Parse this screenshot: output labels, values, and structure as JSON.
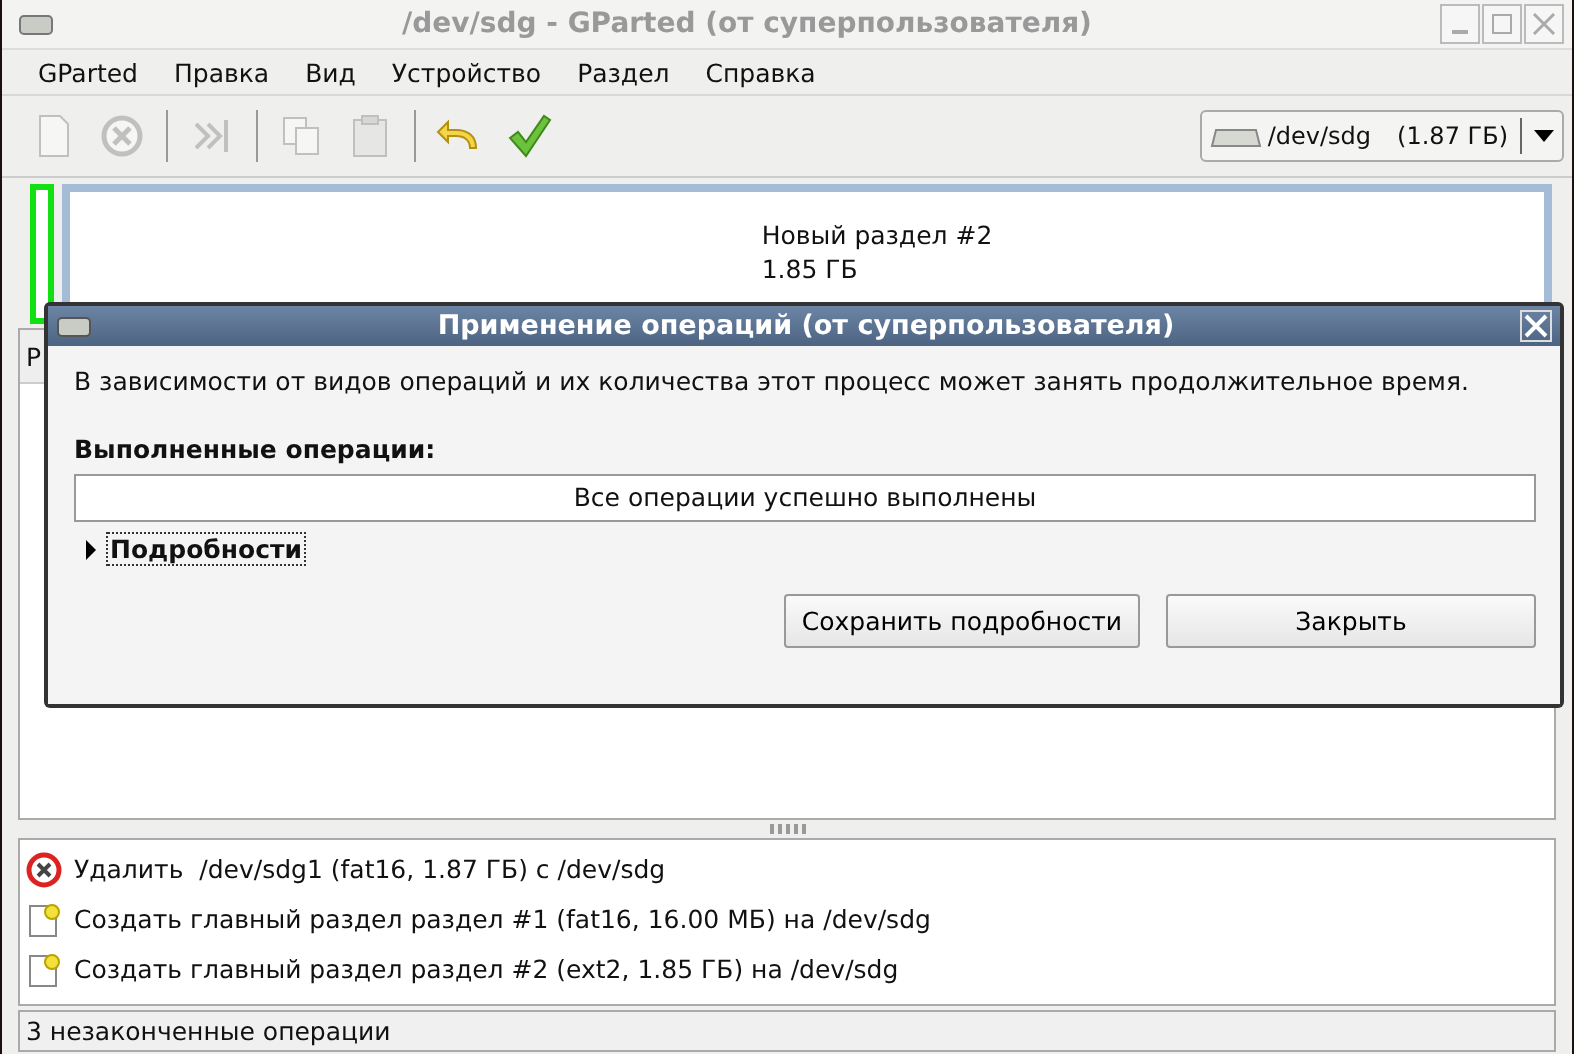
{
  "window": {
    "title": "/dev/sdg - GParted (от суперпользователя)"
  },
  "menu": [
    "GParted",
    "Правка",
    "Вид",
    "Устройство",
    "Раздел",
    "Справка"
  ],
  "toolbar": [
    {
      "kind": "new",
      "disabled": true
    },
    {
      "kind": "delete",
      "disabled": true
    },
    {
      "kind": "sep"
    },
    {
      "kind": "resize",
      "disabled": true
    },
    {
      "kind": "sep"
    },
    {
      "kind": "copy",
      "disabled": true
    },
    {
      "kind": "paste",
      "disabled": true
    },
    {
      "kind": "sep"
    },
    {
      "kind": "undo",
      "disabled": false
    },
    {
      "kind": "apply",
      "disabled": false
    }
  ],
  "device": {
    "name": "/dev/sdg",
    "size": "(1.87 ГБ)"
  },
  "graph": {
    "name": "Новый раздел #2",
    "size": "1.85 ГБ"
  },
  "table": {
    "columns": [
      "Р"
    ]
  },
  "dialog": {
    "title": "Применение операций (от суперпользователя)",
    "message": "В зависимости от видов операций и их количества этот процесс может занять продолжительное время.",
    "heading": "Выполненные операции:",
    "progress": "Все операции успешно выполнены",
    "details": {
      "label": "Подробности",
      "expanded": false
    },
    "buttons": [
      "Сохранить подробности",
      "Закрыть"
    ]
  },
  "operations": [
    {
      "kind": "delete",
      "text": "Удалить  /dev/sdg1 (fat16, 1.87 ГБ) с /dev/sdg"
    },
    {
      "kind": "create",
      "text": "Создать главный раздел раздел #1 (fat16, 16.00 МБ) на /dev/sdg"
    },
    {
      "kind": "create",
      "text": "Создать главный раздел раздел #2 (ext2, 1.85 ГБ) на /dev/sdg"
    }
  ],
  "status_bar": "3 незаконченные операции"
}
